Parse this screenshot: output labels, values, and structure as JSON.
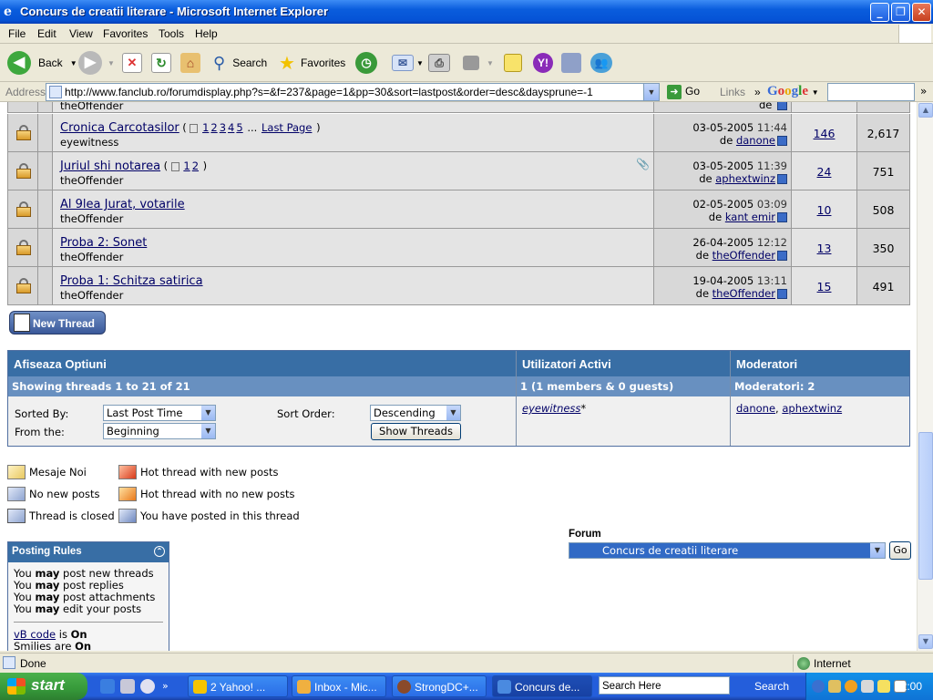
{
  "window": {
    "title": "Concurs de creatii literare - Microsoft Internet Explorer"
  },
  "menu": [
    "File",
    "Edit",
    "View",
    "Favorites",
    "Tools",
    "Help"
  ],
  "toolbar": {
    "back": "Back",
    "search": "Search",
    "favorites": "Favorites"
  },
  "address": {
    "label": "Address",
    "url": "http://www.fanclub.ro/forumdisplay.php?s=&f=237&page=1&pp=30&sort=lastpost&order=desc&daysprune=-1",
    "go": "Go",
    "links": "Links",
    "google": "Google"
  },
  "threads": [
    {
      "title": "Cronica Carcotasilor",
      "pages": [
        "1",
        "2",
        "3",
        "4",
        "5"
      ],
      "ellipsis": "...",
      "last_page": "Last Page",
      "author": "eyewitness",
      "date": "03-05-2005",
      "time": "11:44",
      "by": "de",
      "last_poster": "danone",
      "replies": "146",
      "views": "2,617",
      "attachment": false
    },
    {
      "title": "Juriul shi notarea",
      "pages": [
        "1",
        "2"
      ],
      "ellipsis": "",
      "last_page": "",
      "author": "theOffender",
      "date": "03-05-2005",
      "time": "11:39",
      "by": "de",
      "last_poster": "aphextwinz",
      "replies": "24",
      "views": "751",
      "attachment": true
    },
    {
      "title": "Al 9lea Jurat, votarile",
      "pages": [],
      "ellipsis": "",
      "last_page": "",
      "author": "theOffender",
      "date": "02-05-2005",
      "time": "03:09",
      "by": "de",
      "last_poster": "kant emir",
      "replies": "10",
      "views": "508",
      "attachment": false
    },
    {
      "title": "Proba 2: Sonet",
      "pages": [],
      "ellipsis": "",
      "last_page": "",
      "author": "theOffender",
      "date": "26-04-2005",
      "time": "12:12",
      "by": "de",
      "last_poster": "theOffender",
      "replies": "13",
      "views": "350",
      "attachment": false
    },
    {
      "title": "Proba 1: Schitza satirica",
      "pages": [],
      "ellipsis": "",
      "last_page": "",
      "author": "theOffender",
      "date": "19-04-2005",
      "time": "13:11",
      "by": "de",
      "last_poster": "theOffender",
      "replies": "15",
      "views": "491",
      "attachment": false
    }
  ],
  "partial_row": {
    "author": "theOffender",
    "poster_fragment": "de"
  },
  "new_thread": "New Thread",
  "options": {
    "title": "Afiseaza Optiuni",
    "showing": "Showing threads 1 to 21 of 21",
    "sorted_by_label": "Sorted By:",
    "sorted_by_value": "Last Post Time",
    "from_label": "From the:",
    "from_value": "Beginning",
    "sort_order_label": "Sort Order:",
    "sort_order_value": "Descending",
    "show_button": "Show Threads"
  },
  "active_users": {
    "title": "Utilizatori Activi",
    "summary": "1 (1 members & 0 guests)",
    "user": "eyewitness",
    "marker": "*"
  },
  "moderators": {
    "title": "Moderatori",
    "summary": "Moderatori: 2",
    "list": [
      "danone",
      "aphextwinz"
    ],
    "separator": ","
  },
  "legend": [
    {
      "label": "Mesaje Noi",
      "icon": "new-posts-icon"
    },
    {
      "label": "Hot thread with new posts",
      "icon": "hot-new-icon"
    },
    {
      "label": "No new posts",
      "icon": "no-new-posts-icon"
    },
    {
      "label": "Hot thread with no new posts",
      "icon": "hot-no-new-icon"
    },
    {
      "label": "Thread is closed",
      "icon": "closed-thread-icon"
    },
    {
      "label": "You have posted in this thread",
      "icon": "posted-icon"
    }
  ],
  "forum_jump": {
    "label": "Forum",
    "value": "Concurs de creatii literare",
    "go": "Go"
  },
  "posting_rules": {
    "title": "Posting Rules",
    "lines": [
      {
        "pre": "You",
        "may": "may",
        "post": "post new threads"
      },
      {
        "pre": "You",
        "may": "may",
        "post": "post replies"
      },
      {
        "pre": "You",
        "may": "may",
        "post": "post attachments"
      },
      {
        "pre": "You",
        "may": "may",
        "post": "edit your posts"
      }
    ],
    "vb_code": "vB code",
    "vb_is": "is",
    "vb_state": "On",
    "smilies": "Smilies are",
    "smilies_state": "On"
  },
  "status": {
    "text": "Done",
    "zone": "Internet"
  },
  "taskbar": {
    "start": "start",
    "tasks": [
      "2 Yahoo! ...",
      "Inbox - Mic...",
      "StrongDC+...",
      "Concurs de..."
    ],
    "search_placeholder": "Search Here",
    "search_button": "Search",
    "clock": "12:00"
  },
  "colors": {
    "header_blue": "#386ea5",
    "subheader_blue": "#6890c0",
    "link": "#000066",
    "row_gray": "#e4e4e4"
  }
}
